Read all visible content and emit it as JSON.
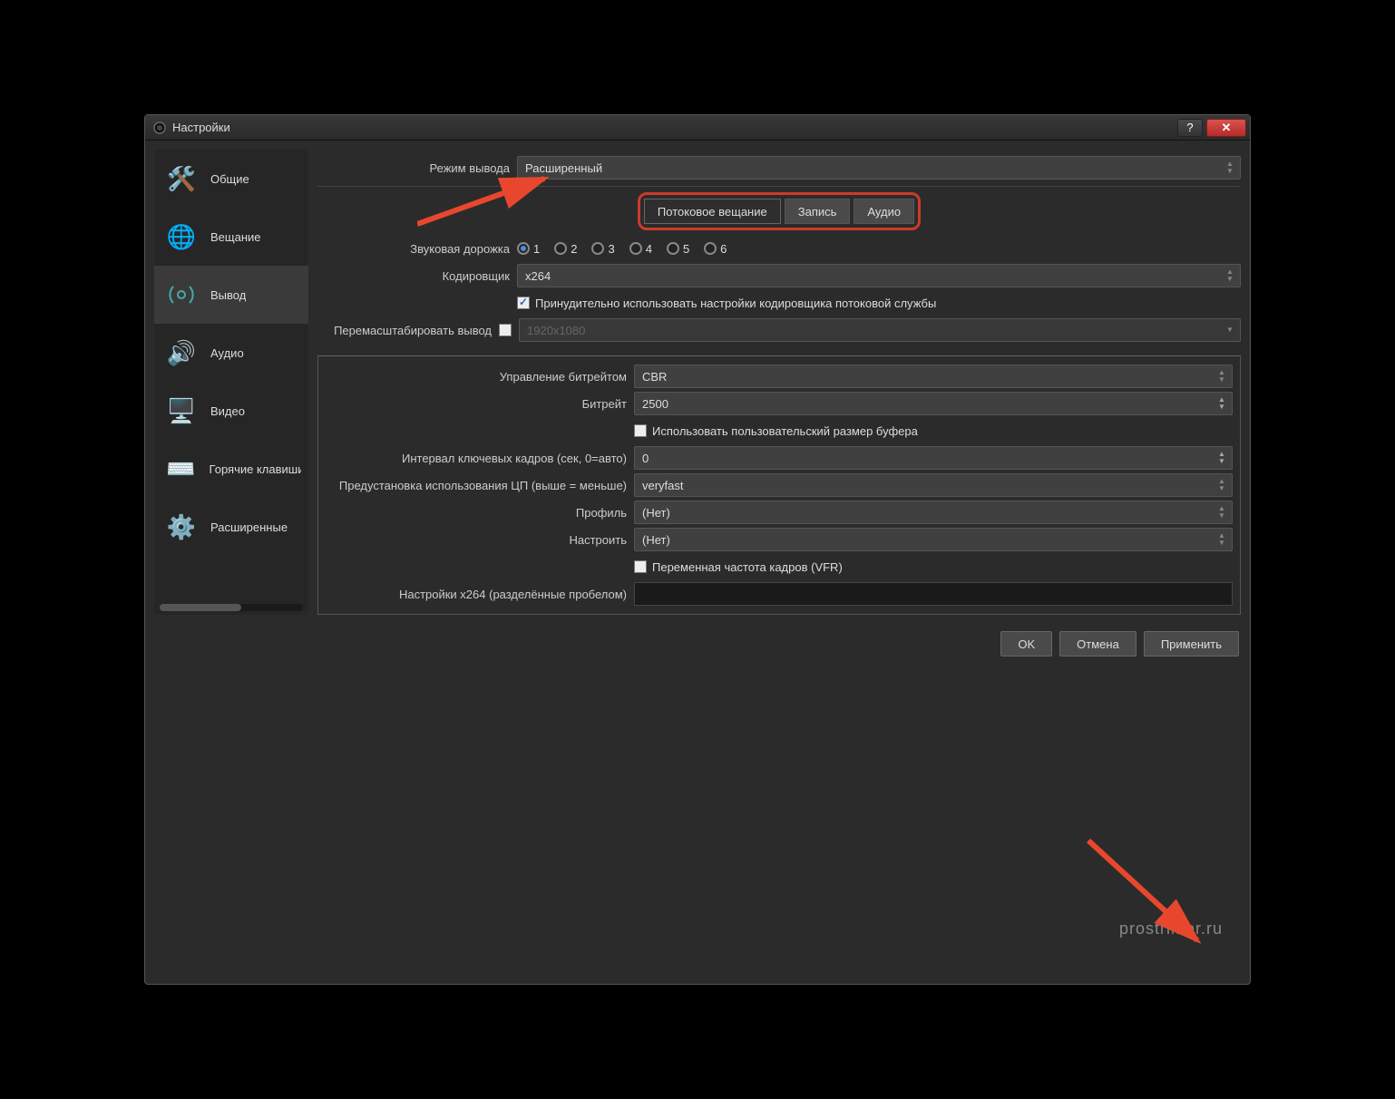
{
  "window": {
    "title": "Настройки"
  },
  "sidebar": {
    "items": [
      {
        "label": "Общие"
      },
      {
        "label": "Вещание"
      },
      {
        "label": "Вывод"
      },
      {
        "label": "Аудио"
      },
      {
        "label": "Видео"
      },
      {
        "label": "Горячие клавиши"
      },
      {
        "label": "Расширенные"
      }
    ]
  },
  "output_mode": {
    "label": "Режим вывода",
    "value": "Расширенный"
  },
  "tabs": {
    "streaming": "Потоковое вещание",
    "recording": "Запись",
    "audio": "Аудио"
  },
  "audio_track": {
    "label": "Звуковая дорожка",
    "options": [
      "1",
      "2",
      "3",
      "4",
      "5",
      "6"
    ],
    "selected": "1"
  },
  "encoder": {
    "label": "Кодировщик",
    "value": "x264"
  },
  "enforce": {
    "label": "Принудительно использовать настройки кодировщика потоковой службы",
    "checked": true
  },
  "rescale": {
    "label": "Перемасштабировать вывод",
    "checked": false,
    "placeholder": "1920x1080"
  },
  "bitrate_control": {
    "label": "Управление битрейтом",
    "value": "CBR"
  },
  "bitrate": {
    "label": "Битрейт",
    "value": "2500"
  },
  "custom_buffer": {
    "label": "Использовать пользовательский размер буфера",
    "checked": false
  },
  "keyframe": {
    "label": "Интервал ключевых кадров (сек, 0=авто)",
    "value": "0"
  },
  "cpu_preset": {
    "label": "Предустановка использования ЦП (выше = меньше)",
    "value": "veryfast"
  },
  "profile": {
    "label": "Профиль",
    "value": "(Нет)"
  },
  "tune": {
    "label": "Настроить",
    "value": "(Нет)"
  },
  "vfr": {
    "label": "Переменная частота кадров (VFR)",
    "checked": false
  },
  "x264opts": {
    "label": "Настройки x264 (разделённые пробелом)",
    "value": ""
  },
  "footer": {
    "ok": "OK",
    "cancel": "Отмена",
    "apply": "Применить"
  },
  "watermark": "prostrimer.ru"
}
